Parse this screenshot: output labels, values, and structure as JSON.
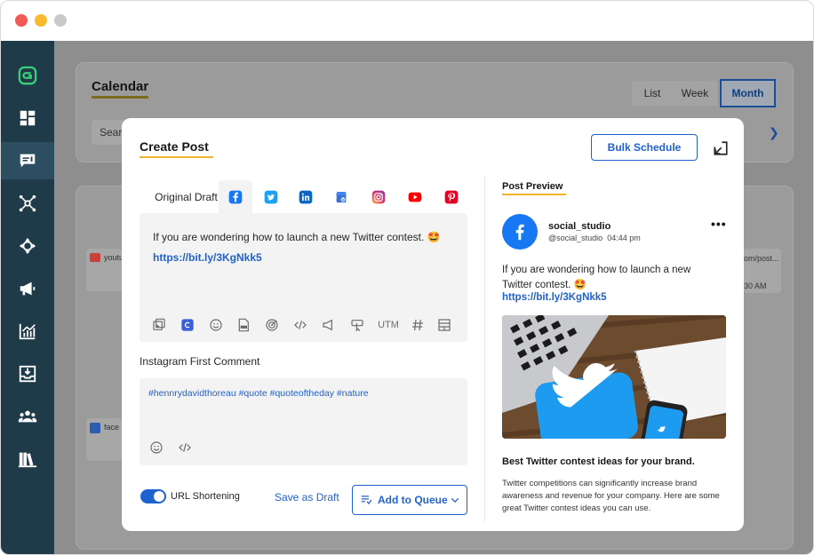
{
  "background": {
    "calendar_title": "Calendar",
    "view_list": "List",
    "view_week": "Week",
    "view_month": "Month",
    "search_partial": "Searc",
    "card_youtube": "youtu",
    "card_facebook": "face",
    "card_right_1": "om/post...",
    "card_right_2": "30 AM"
  },
  "modal": {
    "title": "Create Post",
    "bulk_schedule": "Bulk Schedule",
    "original_draft_tab": "Original Draft",
    "network_tabs": [
      "facebook-icon",
      "twitter-icon",
      "linkedin-icon",
      "google-business-icon",
      "instagram-icon",
      "youtube-icon",
      "pinterest-icon"
    ],
    "editor": {
      "text": "If you are wondering how to launch a new Twitter contest. 🤩",
      "link": "https://bit.ly/3KgNkk5",
      "utm_label": "UTM"
    },
    "instagram": {
      "label": "Instagram First Comment",
      "hashtags": "#hennrydavidthoreau #quote #quoteoftheday #nature"
    },
    "footer": {
      "url_shortening": "URL Shortening",
      "url_shortening_enabled": true,
      "save_as_draft": "Save as Draft",
      "add_to_queue": "Add to Queue"
    }
  },
  "preview": {
    "title": "Post Preview",
    "account_name": "social_studio",
    "handle": "@social_studio",
    "time": "04:44 pm",
    "text": "If you are wondering how to launch a new Twitter contest. 🤩",
    "link": "https://bit.ly/3KgNkk5",
    "headline": "Best Twitter contest ideas for your brand.",
    "description": "Twitter competitions can significantly increase brand awareness and revenue for your company. Here are some great Twitter contest ideas you can use."
  },
  "colors": {
    "accent": "#1f61d0",
    "sidebar": "#1f3b4a",
    "underline": "#f3b429",
    "facebook": "#1877f2"
  }
}
